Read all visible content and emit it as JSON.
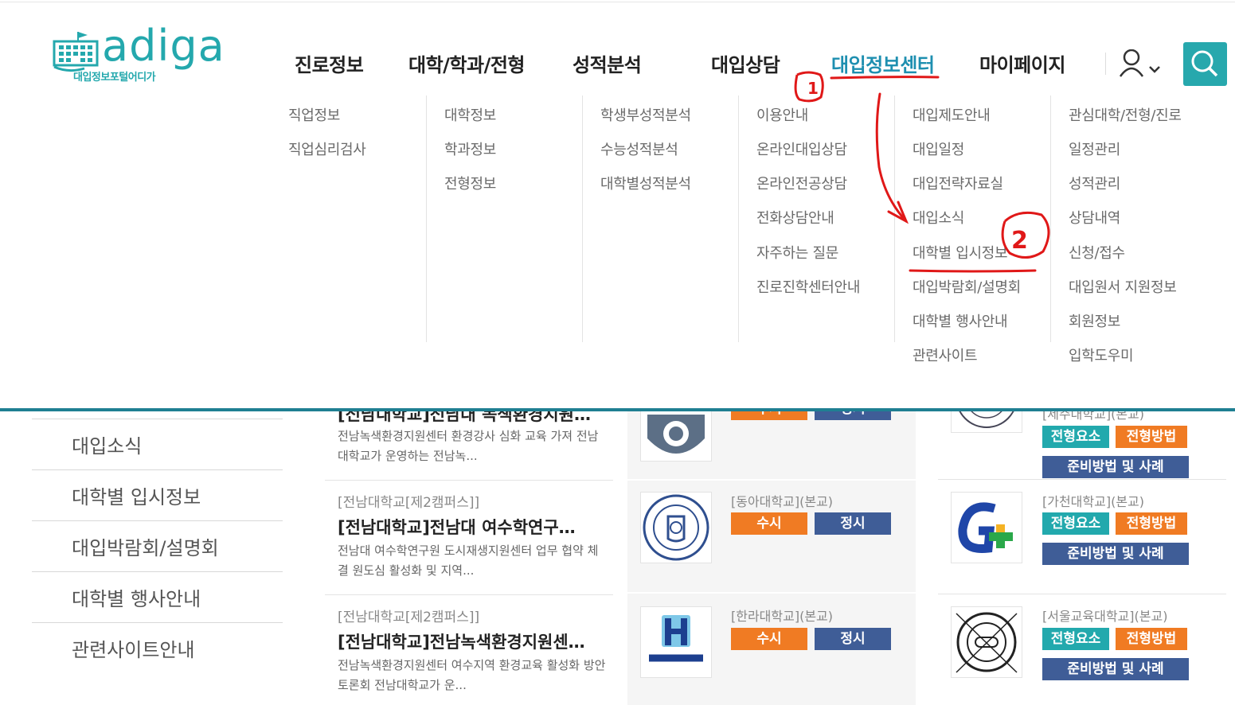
{
  "logo": {
    "word": "adiga",
    "tagline": "대입정보포털어디가"
  },
  "nav": {
    "menus": [
      {
        "label": "진로정보",
        "items": [
          "직업정보",
          "직업심리검사"
        ]
      },
      {
        "label": "대학/학과/전형",
        "items": [
          "대학정보",
          "학과정보",
          "전형정보"
        ]
      },
      {
        "label": "성적분석",
        "items": [
          "학생부성적분석",
          "수능성적분석",
          "대학별성적분석"
        ]
      },
      {
        "label": "대입상담",
        "items": [
          "이용안내",
          "온라인대입상담",
          "온라인전공상담",
          "전화상담안내",
          "자주하는 질문",
          "진로진학센터안내"
        ]
      },
      {
        "label": "대입정보센터",
        "items": [
          "대입제도안내",
          "대입일정",
          "대입전략자료실",
          "대입소식",
          "대학별 입시정보",
          "대입박람회/설명회",
          "대학별 행사안내",
          "관련사이트"
        ]
      },
      {
        "label": "마이페이지",
        "items": [
          "관심대학/전형/진로",
          "일정관리",
          "성적관리",
          "상담내역",
          "신청/접수",
          "대입원서 지원정보",
          "회원정보",
          "입학도우미"
        ]
      }
    ],
    "active_index": 4
  },
  "annotations": {
    "step1": "1",
    "step2": "2"
  },
  "sidebar": {
    "items": [
      "대입소식",
      "대학별 입시정보",
      "대입박람회/설명회",
      "대학별 행사안내",
      "관련사이트안내"
    ]
  },
  "news": [
    {
      "category": "",
      "title": "[전남대학교]전남대 녹색환경지원…",
      "desc": "전남녹색환경지원센터 환경강사 심화 교육 가져 전남대학교가 운영하는 전남녹..."
    },
    {
      "category": "[전남대학교[제2캠퍼스]]",
      "title": "[전남대학교]전남대 여수학연구…",
      "desc": "전남대 여수학연구원 도시재생지원센터 업무 협약 체결 원도심 활성화 및 지역..."
    },
    {
      "category": "[전남대학교[제2캠퍼스]]",
      "title": "[전남대학교]전남녹색환경지원센…",
      "desc": "전남녹색환경지원센터 여수지역 환경교육 활성화 방안 토론회 전남대학교가 운..."
    }
  ],
  "universities_left": [
    {
      "name": "",
      "btn1": "수시",
      "btn2": "정시"
    },
    {
      "name": "[동아대학교](본교)",
      "btn1": "수시",
      "btn2": "정시"
    },
    {
      "name": "[한라대학교](본교)",
      "btn1": "수시",
      "btn2": "정시"
    }
  ],
  "universities_right": [
    {
      "name": "[제주대학교](본교)",
      "btn1": "전형요소",
      "btn2": "전형방법",
      "btn3": "준비방법 및 사례"
    },
    {
      "name": "[가천대학교](본교)",
      "btn1": "전형요소",
      "btn2": "전형방법",
      "btn3": "준비방법 및 사례"
    },
    {
      "name": "[서울교육대학교](본교)",
      "btn1": "전형요소",
      "btn2": "전형방법",
      "btn3": "준비방법 및 사례"
    }
  ],
  "colors": {
    "brand": "#27a8ad",
    "active_menu": "#1e8fb0",
    "annotation": "#e01818",
    "orange": "#f07b23",
    "navy": "#3f5d97",
    "teal": "#22a9ad"
  }
}
